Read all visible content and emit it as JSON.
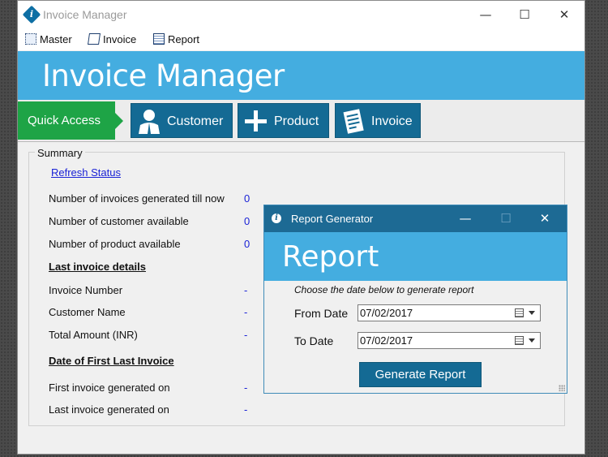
{
  "main_window": {
    "title": "Invoice Manager",
    "controls": {
      "minimize": "—",
      "maximize": "☐",
      "close": "✕"
    }
  },
  "menu": {
    "items": [
      {
        "label": "Master",
        "icon": "master-icon"
      },
      {
        "label": "Invoice",
        "icon": "invoice-icon"
      },
      {
        "label": "Report",
        "icon": "report-icon"
      }
    ]
  },
  "header": {
    "title": "Invoice Manager"
  },
  "quick_access": {
    "label": "Quick Access",
    "buttons": [
      {
        "label": "Customer",
        "icon": "customer-icon"
      },
      {
        "label": "Product",
        "icon": "plus-icon"
      },
      {
        "label": "Invoice",
        "icon": "invoice-doc-icon"
      }
    ]
  },
  "summary": {
    "legend": "Summary",
    "refresh_link": "Refresh Status",
    "rows": [
      {
        "label": "Number of invoices generated till now",
        "value": "0"
      },
      {
        "label": "Number of customer available",
        "value": "0"
      },
      {
        "label": "Number of product available",
        "value": "0"
      }
    ],
    "last_invoice_heading": "Last invoice details",
    "last_invoice_rows": [
      {
        "label": "Invoice Number",
        "value": "-"
      },
      {
        "label": "Customer Name",
        "value": "-"
      },
      {
        "label": "Total Amount (INR)",
        "value": "-"
      }
    ],
    "date_heading": "Date of First  Last Invoice",
    "date_rows": [
      {
        "label": "First invoice generated on",
        "value": "-"
      },
      {
        "label": "Last invoice generated on",
        "value": "-"
      }
    ]
  },
  "report_dialog": {
    "title": "Report Generator",
    "controls": {
      "minimize": "—",
      "maximize": "☐",
      "close": "✕"
    },
    "header_title": "Report",
    "instruction": "Choose the date below to generate report",
    "from_label": "From Date",
    "from_value": "07/02/2017",
    "to_label": "To Date",
    "to_value": "07/02/2017",
    "generate_label": "Generate Report"
  },
  "colors": {
    "accent_blue": "#44ade0",
    "button_blue": "#146a94",
    "quick_green": "#1ea446",
    "link_blue": "#1a22d6"
  }
}
